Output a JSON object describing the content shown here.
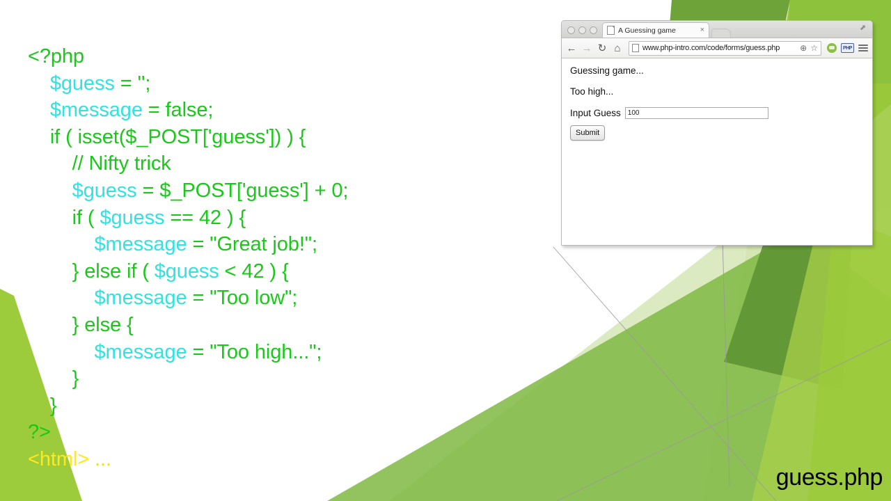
{
  "slide": {
    "caption": "guess.php",
    "background_colors": {
      "white": "#ffffff",
      "green_bright": "#9ccb3b",
      "green_mid": "#7fb843",
      "green_dark": "#5e9434",
      "green_pale": "#d9e8bd",
      "green_light": "#c3de96",
      "line_gray": "#9a9a9a"
    }
  },
  "code": {
    "colors": {
      "keyword_green": "#18c918",
      "variable_cyan": "#2fe3e3",
      "html_tag_yellow": "#ffe81c",
      "ellipsis_olive": "#e8e02a"
    },
    "lines": [
      {
        "indent": 0,
        "tokens": [
          {
            "t": "<?php",
            "c": "code"
          }
        ]
      },
      {
        "indent": 1,
        "tokens": [
          {
            "t": "$guess",
            "c": "var"
          },
          {
            "t": " = '';",
            "c": "code"
          }
        ]
      },
      {
        "indent": 1,
        "tokens": [
          {
            "t": "$message",
            "c": "var"
          },
          {
            "t": " = false;",
            "c": "code"
          }
        ]
      },
      {
        "indent": 1,
        "tokens": [
          {
            "t": "if ( isset($_POST['guess']) ) {",
            "c": "code"
          }
        ]
      },
      {
        "indent": 2,
        "tokens": [
          {
            "t": "// Nifty trick",
            "c": "code"
          }
        ]
      },
      {
        "indent": 2,
        "tokens": [
          {
            "t": "$guess",
            "c": "var"
          },
          {
            "t": " = $_POST['guess'] + 0;",
            "c": "code"
          }
        ]
      },
      {
        "indent": 2,
        "tokens": [
          {
            "t": "if ( ",
            "c": "code"
          },
          {
            "t": "$guess",
            "c": "var"
          },
          {
            "t": " == 42 ) {",
            "c": "code"
          }
        ]
      },
      {
        "indent": 3,
        "tokens": [
          {
            "t": "$message",
            "c": "var"
          },
          {
            "t": " = \"Great job!\";",
            "c": "code"
          }
        ]
      },
      {
        "indent": 2,
        "tokens": [
          {
            "t": "} else if ( ",
            "c": "code"
          },
          {
            "t": "$guess",
            "c": "var"
          },
          {
            "t": " < 42 ) {",
            "c": "code"
          }
        ]
      },
      {
        "indent": 3,
        "tokens": [
          {
            "t": "$message",
            "c": "var"
          },
          {
            "t": " = \"Too low\";",
            "c": "code"
          }
        ]
      },
      {
        "indent": 2,
        "tokens": [
          {
            "t": "} else {",
            "c": "code"
          }
        ]
      },
      {
        "indent": 3,
        "tokens": [
          {
            "t": "$message",
            "c": "var"
          },
          {
            "t": " = \"Too high...\";",
            "c": "code"
          }
        ]
      },
      {
        "indent": 2,
        "tokens": [
          {
            "t": "}",
            "c": "code"
          }
        ]
      },
      {
        "indent": 1,
        "tokens": [
          {
            "t": "}",
            "c": "code"
          }
        ]
      },
      {
        "indent": 0,
        "tokens": [
          {
            "t": "?>",
            "c": "code"
          }
        ]
      },
      {
        "indent": 0,
        "tokens": [
          {
            "t": "<html>",
            "c": "tag"
          },
          {
            "t": " ...",
            "c": "dots"
          }
        ]
      }
    ]
  },
  "browser": {
    "window_controls": [
      "close-dot",
      "minimize-dot",
      "zoom-dot"
    ],
    "tab": {
      "title": "A Guessing game",
      "close_label": "×",
      "page_icon": "page-icon"
    },
    "maximize_label": "⬈",
    "toolbar": {
      "back_label": "←",
      "forward_label": "→",
      "reload_label": "↻",
      "home_label": "⌂",
      "url": "www.php-intro.com/code/forms/guess.php",
      "zoom_label": "⊕",
      "bookmark_label": "☆",
      "extension_php_label": "PHP"
    },
    "page": {
      "heading": "Guessing game...",
      "message": "Too high...",
      "input_label": "Input Guess",
      "input_value": "100",
      "input_placeholder": "",
      "submit_label": "Submit"
    }
  }
}
